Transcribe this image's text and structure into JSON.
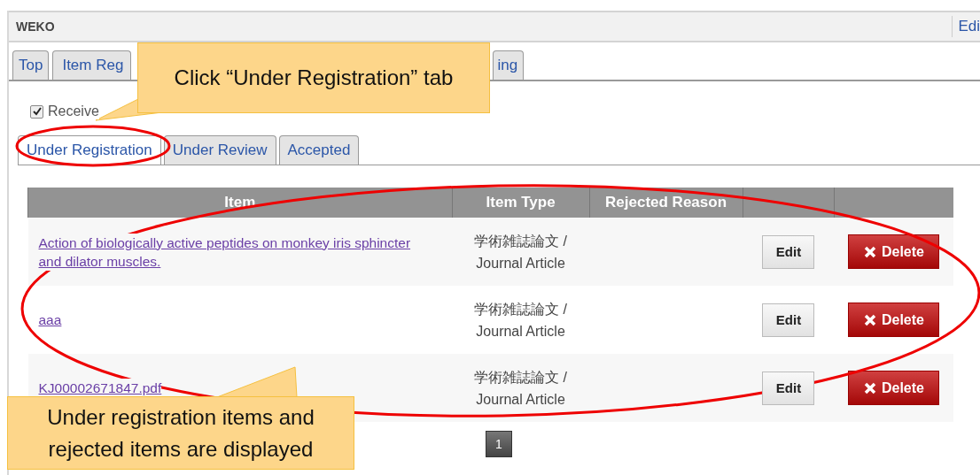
{
  "header": {
    "title": "WEKO",
    "link": "Edi"
  },
  "main_tabs": [
    {
      "label": "Top"
    },
    {
      "label": "Item Reg"
    },
    {
      "label": "ing"
    }
  ],
  "receive_review": {
    "label": "Receive",
    "checked": true
  },
  "sub_tabs": [
    {
      "label": "Under Registration",
      "selected": true
    },
    {
      "label": "Under Review",
      "selected": false
    },
    {
      "label": "Accepted",
      "selected": false
    }
  ],
  "table": {
    "columns": [
      "Item",
      "Item Type",
      "Rejected Reason"
    ],
    "rows": [
      {
        "title": "Action of biologically active peptides on monkey iris sphincter and dilator muscles.",
        "item_type": [
          "学術雑誌論文 /",
          "Journal Article"
        ],
        "edit": "Edit",
        "delete": "Delete"
      },
      {
        "title": "aaa",
        "item_type": [
          "学術雑誌論文 /",
          "Journal Article"
        ],
        "edit": "Edit",
        "delete": "Delete"
      },
      {
        "title": "KJ00002671847.pdf",
        "item_type": [
          "学術雑誌論文 /",
          "Journal Article"
        ],
        "edit": "Edit",
        "delete": "Delete"
      }
    ]
  },
  "pagination": [
    {
      "label": "1",
      "selected": true
    }
  ],
  "annotations": [
    {
      "text": "Click “Under Registration” tab"
    },
    {
      "text": "Under registration items and rejected items are displayed"
    }
  ]
}
